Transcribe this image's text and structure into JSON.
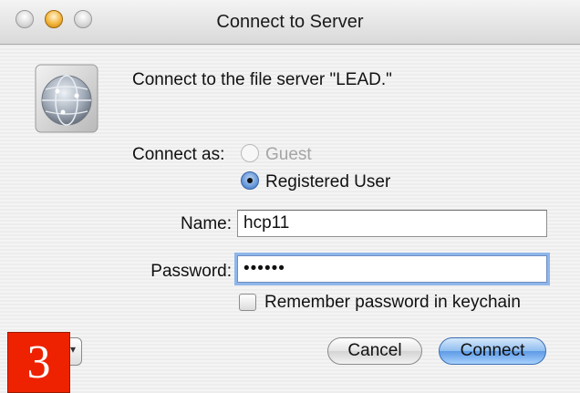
{
  "window": {
    "title": "Connect to Server"
  },
  "message": "Connect to the file server \"LEAD.\"",
  "connect_as": {
    "label": "Connect as:",
    "options": [
      {
        "label": "Guest",
        "selected": false,
        "enabled": false
      },
      {
        "label": "Registered User",
        "selected": true,
        "enabled": true
      }
    ]
  },
  "fields": {
    "name": {
      "label": "Name:",
      "value": "hcp11"
    },
    "password": {
      "label": "Password:",
      "value": "••••••"
    }
  },
  "remember": {
    "label": "Remember password in keychain",
    "checked": false
  },
  "buttons": {
    "cancel": "Cancel",
    "connect": "Connect"
  },
  "badge": "3",
  "icons": [
    "close-button-icon",
    "minimize-button-icon",
    "zoom-button-icon",
    "server-globe-icon",
    "chevron-down-icon"
  ],
  "colors": {
    "accent": "#5d9ae6",
    "badge": "#ee2200",
    "focus_ring": "#8fb6ea"
  }
}
